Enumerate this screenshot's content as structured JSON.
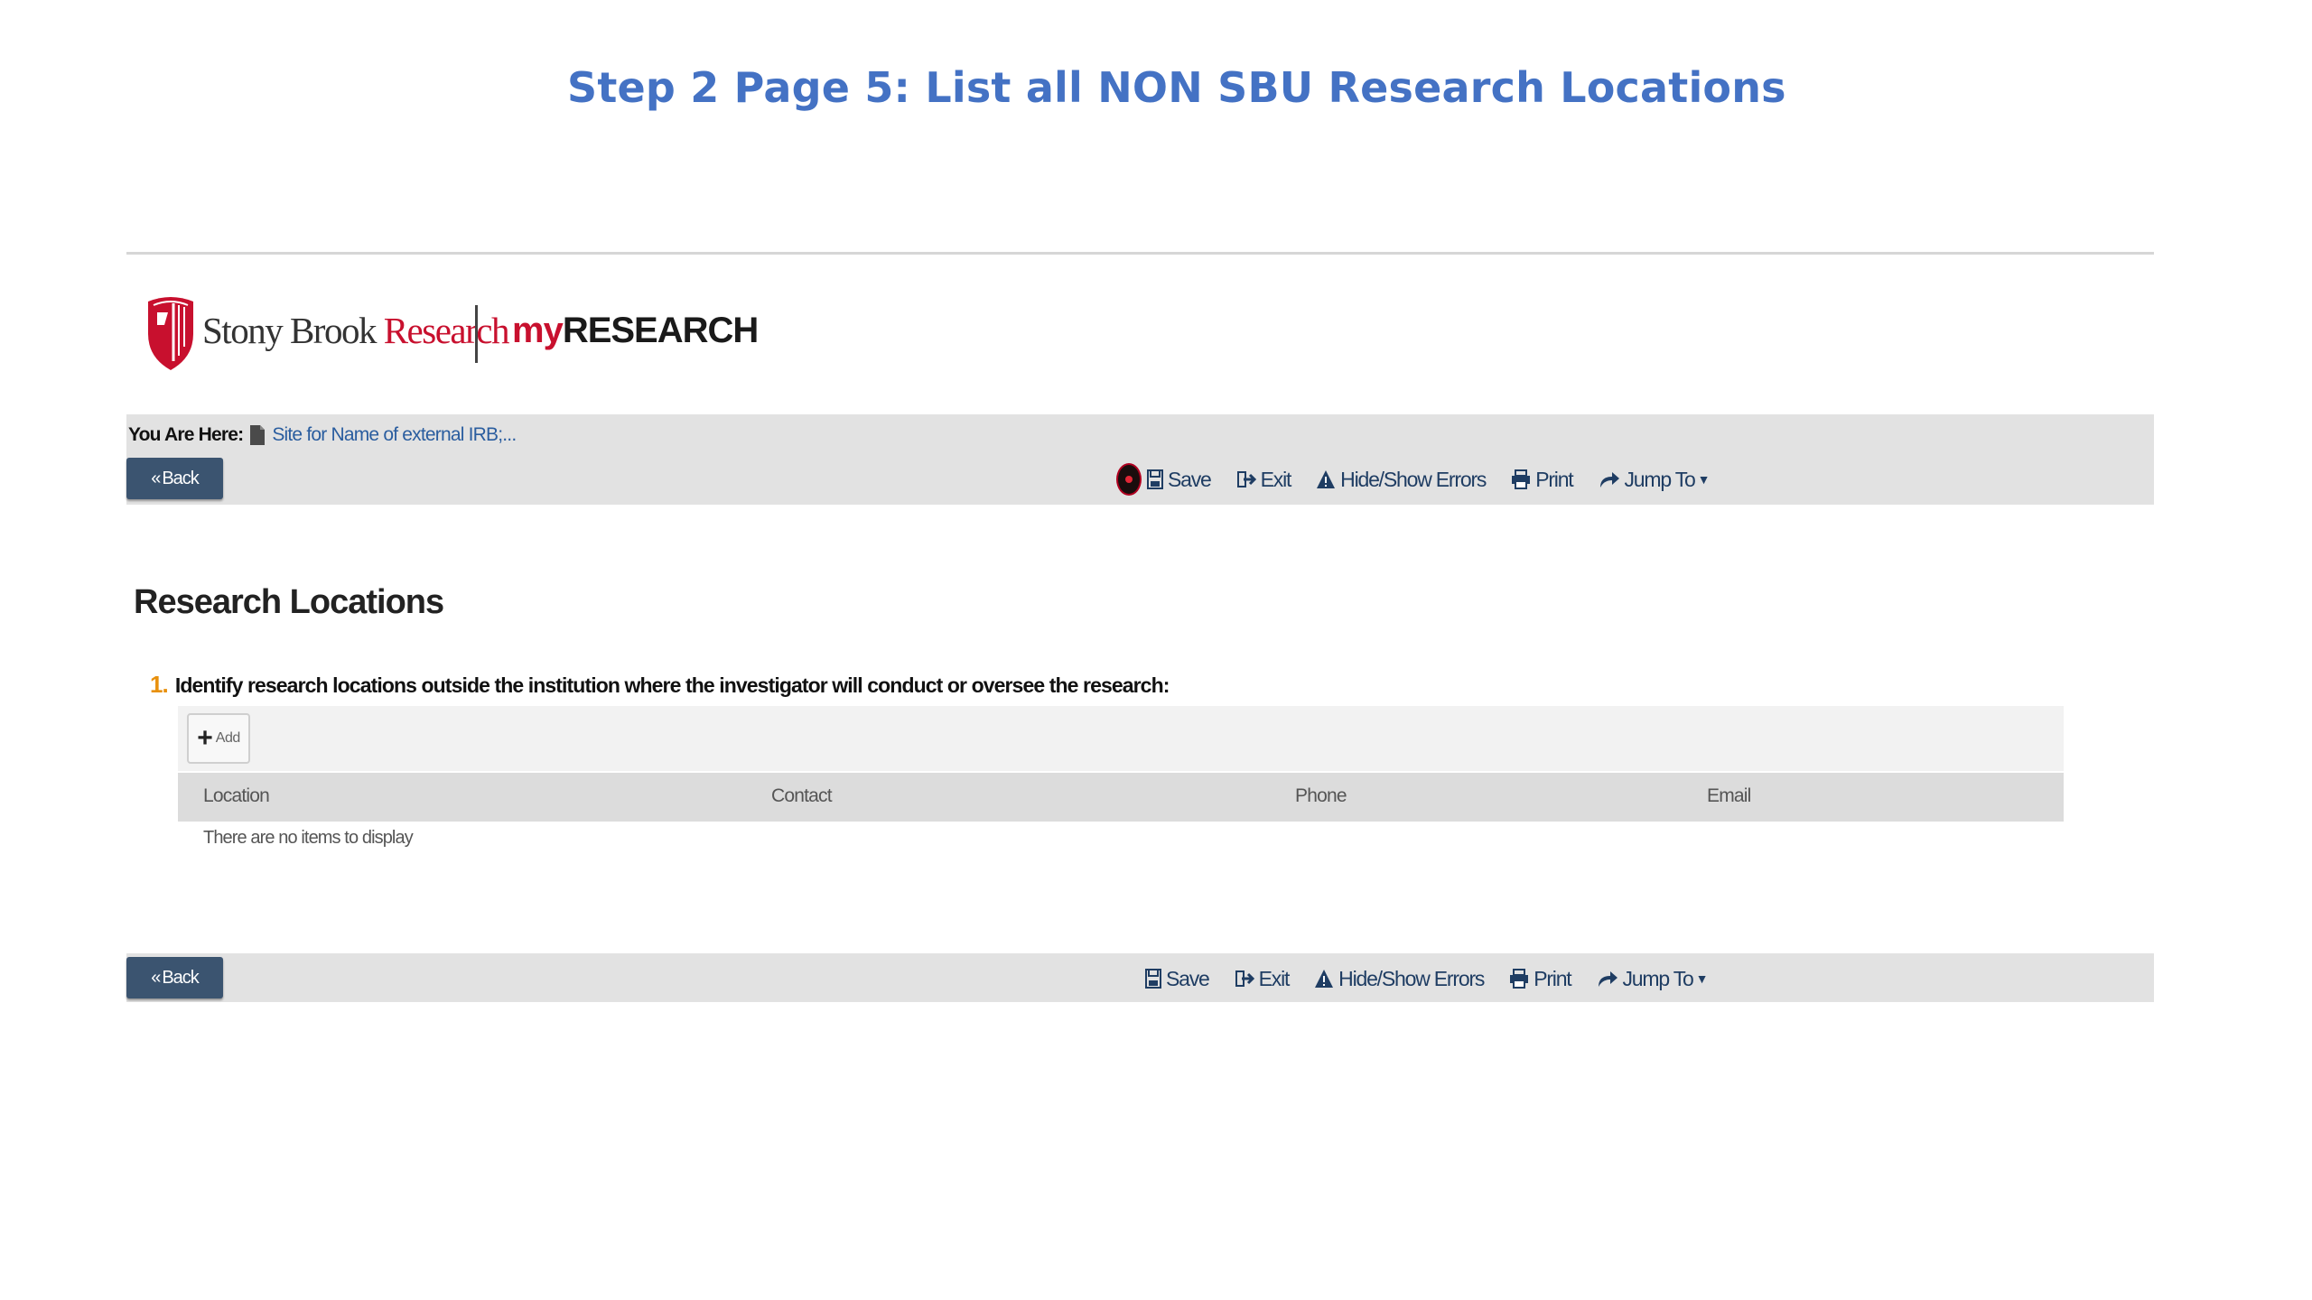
{
  "slide_title": "Step 2 Page 5: List all NON SBU Research Locations",
  "brand": {
    "name_part1": "Stony Brook ",
    "name_part2": "Research",
    "product_part1": "my",
    "product_part2": "RESEARCH"
  },
  "breadcrumb": {
    "label": "You Are Here:",
    "link": "Site for Name of external IRB;..."
  },
  "toolbar": {
    "back_label": "Back",
    "save_label": "Save",
    "exit_label": "Exit",
    "errors_label": "Hide/Show Errors",
    "print_label": "Print",
    "jump_label": "Jump To"
  },
  "section": {
    "title": "Research Locations",
    "question_number": "1.",
    "question_text": "Identify research locations outside the institution where the investigator will conduct or oversee the research:",
    "add_label": "Add",
    "columns": [
      "Location",
      "Contact",
      "Phone",
      "Email"
    ],
    "empty_message": "There are no items to display"
  },
  "colors": {
    "title_blue": "#4472c4",
    "brand_red": "#c8102e",
    "toolbar_gray": "#e2e2e2",
    "back_button": "#3b5470",
    "link_blue": "#2a5d9f",
    "question_number": "#e8900c"
  },
  "icons": {
    "error": "error-indicator-icon",
    "save": "floppy-disk-icon",
    "exit": "exit-door-icon",
    "errors": "warning-triangle-icon",
    "print": "printer-icon",
    "jump": "share-arrow-icon",
    "add": "plus-icon"
  }
}
